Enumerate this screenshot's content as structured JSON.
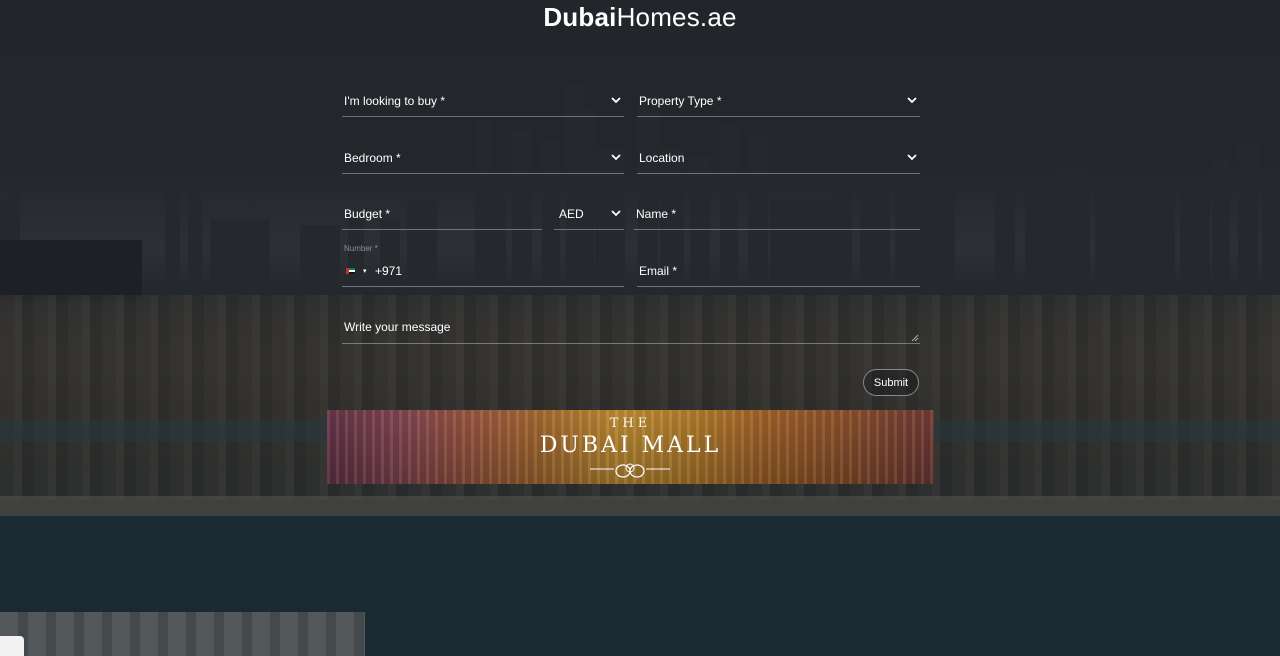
{
  "logo": {
    "bold": "Dubai",
    "light": "Homes.ae"
  },
  "form": {
    "looking_to_buy": {
      "label": "I'm looking to buy *"
    },
    "property_type": {
      "label": "Property Type *"
    },
    "bedroom": {
      "label": "Bedroom *"
    },
    "location": {
      "label": "Location"
    },
    "budget": {
      "label": "Budget *",
      "currency": "AED"
    },
    "name": {
      "label": "Name *"
    },
    "phone": {
      "small_label": "Number *",
      "dial_code": "+971",
      "country_flag": "uae-flag-icon"
    },
    "email": {
      "label": "Email *"
    },
    "message": {
      "placeholder": "Write your message"
    },
    "submit_label": "Submit"
  },
  "banner": {
    "line1": "THE",
    "line2": "DUBAI MALL"
  },
  "colors": {
    "text": "#ffffff",
    "field_line": "rgba(255,255,255,0.35)"
  }
}
